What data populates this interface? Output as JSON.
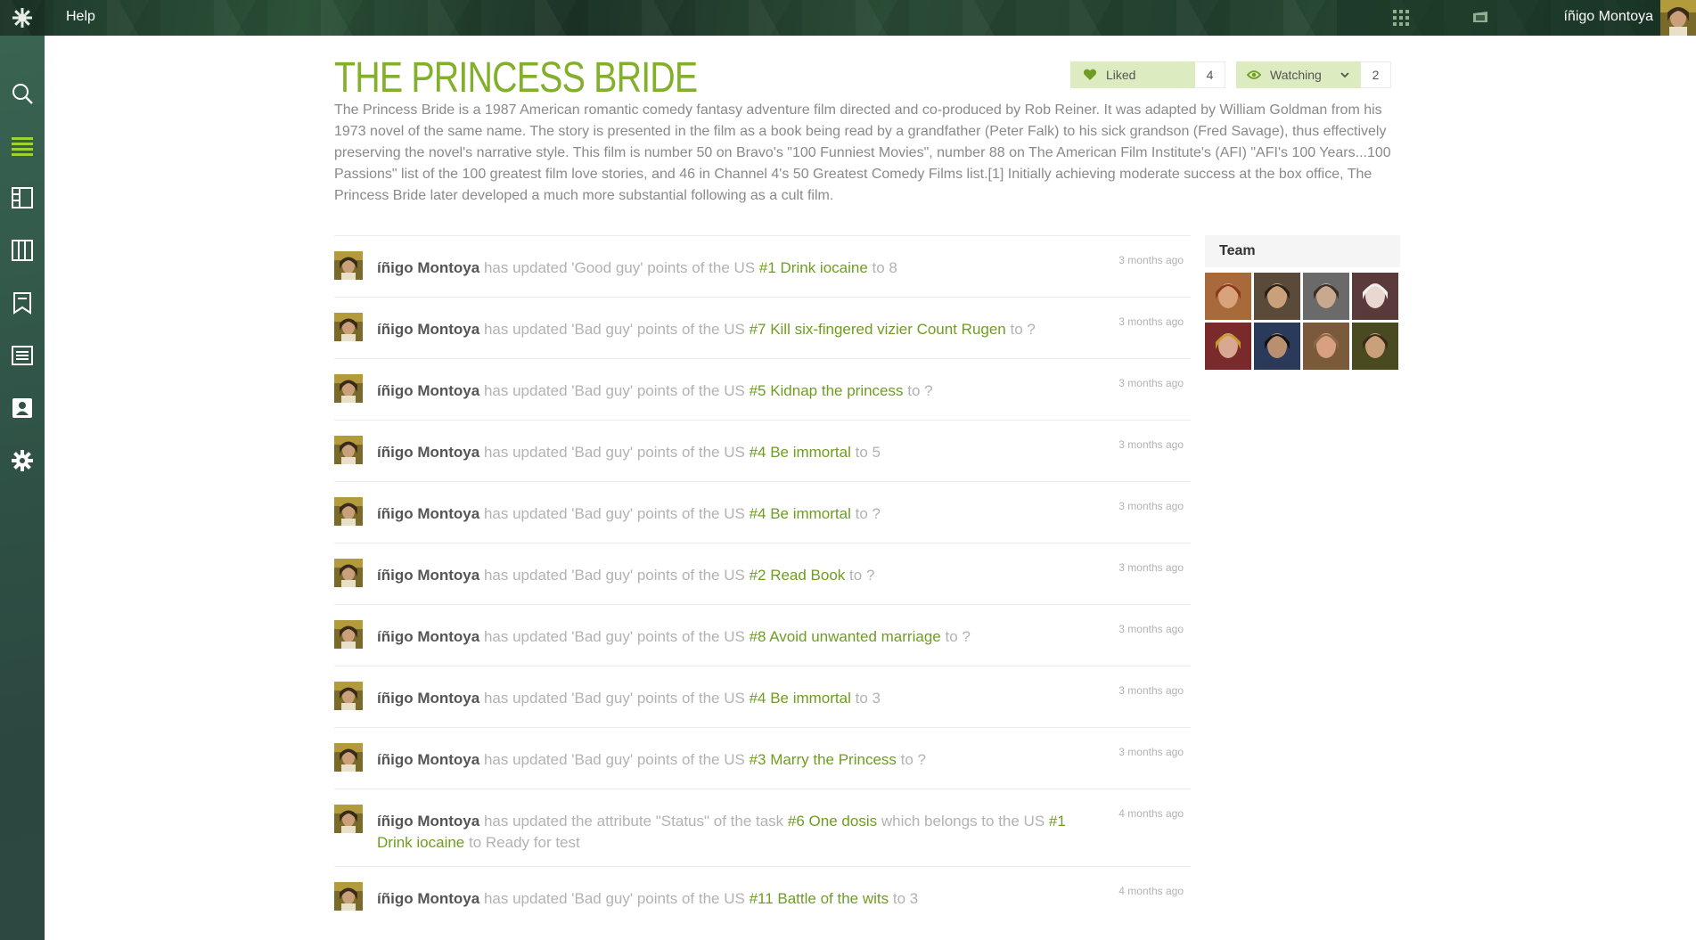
{
  "topbar": {
    "help_label": "Help",
    "user_name": "íñigo Montoya",
    "icons": [
      "taiga-logo-icon",
      "apps-grid-icon",
      "projects-icon"
    ]
  },
  "sidebar": {
    "items": [
      {
        "name": "search",
        "icon": "search-icon",
        "active": false
      },
      {
        "name": "timeline",
        "icon": "list-icon",
        "active": true
      },
      {
        "name": "backlog",
        "icon": "backlog-icon",
        "active": false
      },
      {
        "name": "kanban",
        "icon": "kanban-icon",
        "active": false
      },
      {
        "name": "wiki",
        "icon": "wiki-icon",
        "active": false
      },
      {
        "name": "issues",
        "icon": "issues-icon",
        "active": false
      },
      {
        "name": "team",
        "icon": "team-icon",
        "active": false
      },
      {
        "name": "admin",
        "icon": "gear-icon",
        "active": false
      }
    ]
  },
  "project": {
    "title": "THE PRINCESS BRIDE",
    "description": "The Princess Bride is a 1987 American romantic comedy fantasy adventure film directed and co-produced by Rob Reiner. It was adapted by William Goldman from his 1973 novel of the same name. The story is presented in the film as a book being read by a grandfather (Peter Falk) to his sick grandson (Fred Savage), thus effectively preserving the novel's narrative style. This film is number 50 on Bravo's \"100 Funniest Movies\", number 88 on The American Film Institute's (AFI) \"AFI's 100 Years...100 Passions\" list of the 100 greatest film love stories, and 46 in Channel 4's 50 Greatest Comedy Films list.[1] Initially achieving moderate success at the box office, The Princess Bride later developed a much more substantial following as a cult film.",
    "liked_label": "Liked",
    "liked_count": "4",
    "watching_label": "Watching",
    "watching_count": "2"
  },
  "timeline": [
    {
      "user": "íñigo Montoya",
      "pre": "has updated 'Good guy' points of the US",
      "link": "#1 Drink iocaine",
      "post": "to 8",
      "time": "3 months ago"
    },
    {
      "user": "íñigo Montoya",
      "pre": "has updated 'Bad guy' points of the US",
      "link": "#7 Kill six-fingered vizier Count Rugen",
      "post": "to ?",
      "time": "3 months ago"
    },
    {
      "user": "íñigo Montoya",
      "pre": "has updated 'Bad guy' points of the US",
      "link": "#5 Kidnap the princess",
      "post": "to ?",
      "time": "3 months ago"
    },
    {
      "user": "íñigo Montoya",
      "pre": "has updated 'Bad guy' points of the US",
      "link": "#4 Be immortal",
      "post": "to 5",
      "time": "3 months ago"
    },
    {
      "user": "íñigo Montoya",
      "pre": "has updated 'Bad guy' points of the US",
      "link": "#4 Be immortal",
      "post": "to ?",
      "time": "3 months ago"
    },
    {
      "user": "íñigo Montoya",
      "pre": "has updated 'Bad guy' points of the US",
      "link": "#2 Read Book",
      "post": "to ?",
      "time": "3 months ago"
    },
    {
      "user": "íñigo Montoya",
      "pre": "has updated 'Bad guy' points of the US",
      "link": "#8 Avoid unwanted marriage",
      "post": "to ?",
      "time": "3 months ago"
    },
    {
      "user": "íñigo Montoya",
      "pre": "has updated 'Bad guy' points of the US",
      "link": "#4 Be immortal",
      "post": "to 3",
      "time": "3 months ago"
    },
    {
      "user": "íñigo Montoya",
      "pre": "has updated 'Bad guy' points of the US",
      "link": "#3 Marry the Princess",
      "post": "to ?",
      "time": "3 months ago"
    },
    {
      "user": "íñigo Montoya",
      "pre": "has updated the attribute \"Status\" of the task",
      "link": "#6 One dosis",
      "mid": "which belongs to the US",
      "link2": "#1 Drink iocaine",
      "post": "to Ready for test",
      "time": "4 months ago"
    },
    {
      "user": "íñigo Montoya",
      "pre": "has updated 'Bad guy' points of the US",
      "link": "#11 Battle of the wits",
      "post": "to 3",
      "time": "4 months ago"
    }
  ],
  "team": {
    "title": "Team",
    "member_count": 8
  },
  "colors": {
    "accent": "#83b02a",
    "link": "#6f9d22",
    "button_bg": "#dcebc0",
    "muted_text": "#b2b2b2"
  }
}
